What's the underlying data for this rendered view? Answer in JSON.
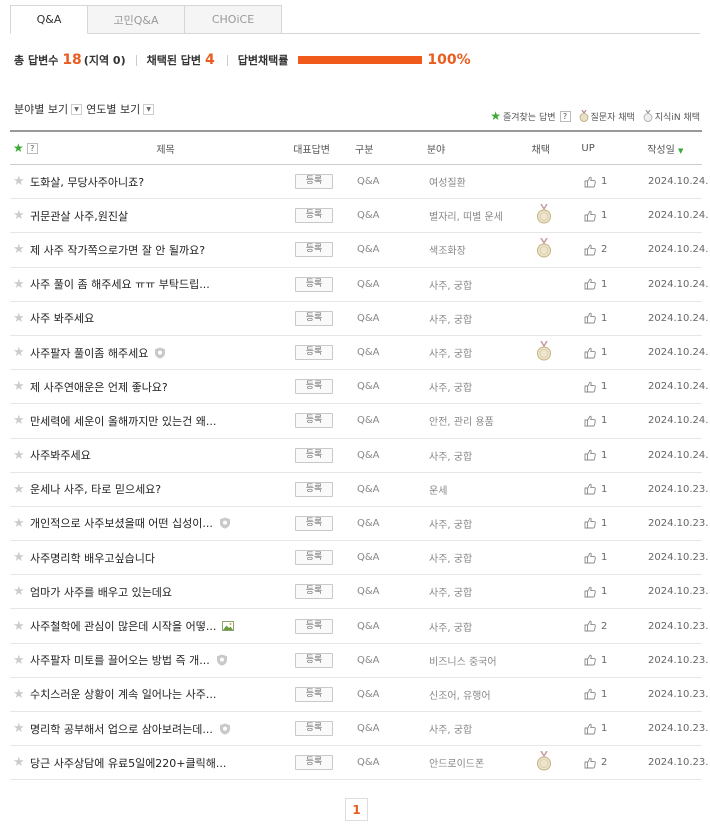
{
  "tabs": [
    {
      "label": "Q&A"
    },
    {
      "label": "고민Q&A"
    },
    {
      "label": "CHOiCE"
    }
  ],
  "stats": {
    "total_label": "총 답변수",
    "total": "18",
    "region": "(지역 0)",
    "region_prefix": "(지역",
    "region_num": "0",
    "region_suffix": ")",
    "chosen_label": "채택된 답변",
    "chosen": "4",
    "rate_label": "답변채택률",
    "rate": "100%",
    "rate_value": 1.0
  },
  "filters": {
    "field": "분야별 보기",
    "year": "연도별 보기"
  },
  "legend": {
    "fav": "즐겨찾는 답변",
    "q_choice": "질문자 채택",
    "kin_choice": "지식iN 채택",
    "help": "?"
  },
  "columns": {
    "help": "?",
    "title": "제목",
    "answer": "대표답변",
    "type": "구분",
    "field": "분야",
    "chosen": "채택",
    "up": "UP",
    "date": "작성일"
  },
  "rows": [
    {
      "title": "도화살, 무당사주아니죠?",
      "btn": "등록",
      "type": "Q&A",
      "field": "여성질환",
      "medal": false,
      "up": "1",
      "date": "2024.10.24.",
      "icon": ""
    },
    {
      "title": "귀문관살 사주,원진살",
      "btn": "등록",
      "type": "Q&A",
      "field": "별자리, 띠별 운세",
      "medal": true,
      "up": "1",
      "date": "2024.10.24.",
      "icon": ""
    },
    {
      "title": "제 사주 작가쪽으로가면 잘 안 될까요?",
      "btn": "등록",
      "type": "Q&A",
      "field": "색조화장",
      "medal": true,
      "up": "2",
      "date": "2024.10.24.",
      "icon": ""
    },
    {
      "title": "사주 풀이 좀 해주세요 ㅠㅠ 부탁드립...",
      "btn": "등록",
      "type": "Q&A",
      "field": "사주, 궁합",
      "medal": false,
      "up": "1",
      "date": "2024.10.24.",
      "icon": ""
    },
    {
      "title": "사주 봐주세요",
      "btn": "등록",
      "type": "Q&A",
      "field": "사주, 궁합",
      "medal": false,
      "up": "1",
      "date": "2024.10.24.",
      "icon": ""
    },
    {
      "title": "사주팔자 풀이좀 해주세요",
      "btn": "등록",
      "type": "Q&A",
      "field": "사주, 궁합",
      "medal": true,
      "up": "1",
      "date": "2024.10.24.",
      "icon": "shield"
    },
    {
      "title": "제 사주연애운은 언제 좋나요?",
      "btn": "등록",
      "type": "Q&A",
      "field": "사주, 궁합",
      "medal": false,
      "up": "1",
      "date": "2024.10.24.",
      "icon": ""
    },
    {
      "title": "만세력에 세운이 올해까지만 있는건 왜...",
      "btn": "등록",
      "type": "Q&A",
      "field": "안전, 관리 용품",
      "medal": false,
      "up": "1",
      "date": "2024.10.24.",
      "icon": ""
    },
    {
      "title": "사주봐주세요",
      "btn": "등록",
      "type": "Q&A",
      "field": "사주, 궁합",
      "medal": false,
      "up": "1",
      "date": "2024.10.24.",
      "icon": ""
    },
    {
      "title": "운세나 사주, 타로 믿으세요?",
      "btn": "등록",
      "type": "Q&A",
      "field": "운세",
      "medal": false,
      "up": "1",
      "date": "2024.10.23.",
      "icon": ""
    },
    {
      "title": "개인적으로 사주보셨을때 어떤 십성이...",
      "btn": "등록",
      "type": "Q&A",
      "field": "사주, 궁합",
      "medal": false,
      "up": "1",
      "date": "2024.10.23.",
      "icon": "shield"
    },
    {
      "title": "사주명리학 배우고싶습니다",
      "btn": "등록",
      "type": "Q&A",
      "field": "사주, 궁합",
      "medal": false,
      "up": "1",
      "date": "2024.10.23.",
      "icon": ""
    },
    {
      "title": "엄마가 사주를 배우고 있는데요",
      "btn": "등록",
      "type": "Q&A",
      "field": "사주, 궁합",
      "medal": false,
      "up": "1",
      "date": "2024.10.23.",
      "icon": ""
    },
    {
      "title": "사주철학에 관심이 많은데 시작을 어떻...",
      "btn": "등록",
      "type": "Q&A",
      "field": "사주, 궁합",
      "medal": false,
      "up": "2",
      "date": "2024.10.23.",
      "icon": "image"
    },
    {
      "title": "사주팔자 미토를 끌어오는 방법 즉 개...",
      "btn": "등록",
      "type": "Q&A",
      "field": "비즈니스 중국어",
      "medal": false,
      "up": "1",
      "date": "2024.10.23.",
      "icon": "shield"
    },
    {
      "title": "수치스러운 상황이 계속 일어나는 사주...",
      "btn": "등록",
      "type": "Q&A",
      "field": "신조어, 유행어",
      "medal": false,
      "up": "1",
      "date": "2024.10.23.",
      "icon": ""
    },
    {
      "title": "명리학 공부해서 업으로 삼아보려는데...",
      "btn": "등록",
      "type": "Q&A",
      "field": "사주, 궁합",
      "medal": false,
      "up": "1",
      "date": "2024.10.23.",
      "icon": "shield"
    },
    {
      "title": "당근 사주상담에 유료5일에220+클릭해...",
      "btn": "등록",
      "type": "Q&A",
      "field": "안드로이드폰",
      "medal": true,
      "up": "2",
      "date": "2024.10.23.",
      "icon": ""
    }
  ],
  "pager": {
    "current": "1"
  },
  "colors": {
    "accent": "#e95d20",
    "green": "#3aa935"
  }
}
